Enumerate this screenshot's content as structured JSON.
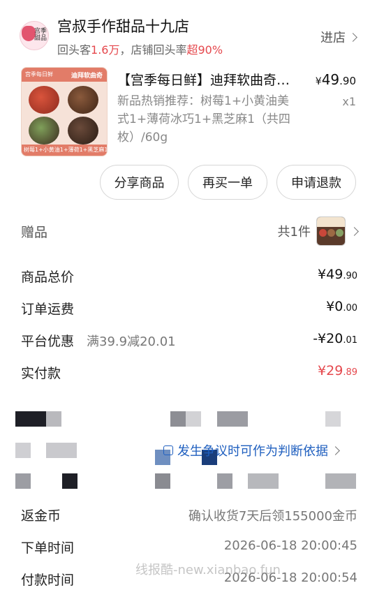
{
  "store": {
    "name": "宫叔手作甜品十九店",
    "logo_text": "宫季 甜品",
    "stats_prefix": "回头客",
    "repeat_customers": "1.6万",
    "stats_mid": "，店铺回头率",
    "repeat_rate": "超90%",
    "enter_label": "进店"
  },
  "product": {
    "title": "【宫季每日鲜】迪拜软曲奇…",
    "price_currency": "¥",
    "price_int": "49",
    "price_dec": ".90",
    "spec": "新品热销推荐：树莓1+小黄油美式1+薄荷冰巧1+黑芝麻1（共四枚）/60g",
    "qty": "x1",
    "thumb_band_left": "宫季每日鲜",
    "thumb_band_right": "迪拜软曲奇",
    "thumb_footer": "树莓1+小黄油1+薄荷1+黑芝麻1"
  },
  "actions": {
    "share": "分享商品",
    "rebuy": "再买一单",
    "refund": "申请退款"
  },
  "gift": {
    "label": "赠品",
    "count": "共1件"
  },
  "summary": {
    "total_label": "商品总价",
    "total_int": "¥49",
    "total_dec": ".90",
    "shipping_label": "订单运费",
    "shipping_int": "¥0",
    "shipping_dec": ".00",
    "discount_label": "平台优惠",
    "discount_note": "满39.9减20.01",
    "discount_int": "-¥20",
    "discount_dec": ".01",
    "paid_label": "实付款",
    "paid_int": "¥29",
    "paid_dec": ".89"
  },
  "evidence_link": "发生争议时可作为判断依据",
  "info": {
    "coins_label": "返金币",
    "coins_value": "确认收货7天后领155000金币",
    "order_time_label": "下单时间",
    "order_time_value": "2026-06-18 20:00:45",
    "pay_time_label": "付款时间",
    "pay_time_value": "2026-06-18 20:00:54"
  },
  "watermark": "线报酷-new.xianbao.fun",
  "colors": {
    "accent_red": "#e5484d",
    "link_blue": "#1f5fbf"
  }
}
